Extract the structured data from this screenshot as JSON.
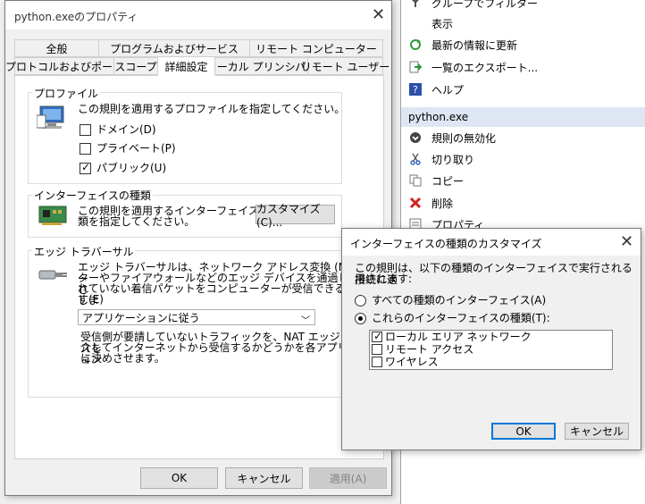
{
  "actions_pane": {
    "items_top": [
      {
        "label": "グループでフィルター",
        "icon": "filter-icon"
      },
      {
        "label": "表示",
        "icon": ""
      },
      {
        "label": "最新の情報に更新",
        "icon": "refresh-icon"
      },
      {
        "label": "一覧のエクスポート...",
        "icon": "export-icon"
      },
      {
        "label": "ヘルプ",
        "icon": "help-icon"
      }
    ],
    "section_title": "python.exe",
    "items_section": [
      {
        "label": "規則の無効化",
        "icon": "disable-icon"
      },
      {
        "label": "切り取り",
        "icon": "cut-icon"
      },
      {
        "label": "コピー",
        "icon": "copy-icon"
      },
      {
        "label": "削除",
        "icon": "delete-icon"
      },
      {
        "label": "プロパティ",
        "icon": "properties-icon"
      }
    ]
  },
  "props_dialog": {
    "title": "python.exeのプロパティ",
    "tabs_row1": [
      "全般",
      "プログラムおよびサービス",
      "リモート コンピューター"
    ],
    "tabs_row2": [
      "プロトコルおよびポート",
      "スコープ",
      "詳細設定",
      "ローカル プリンシパル",
      "リモート ユーザー"
    ],
    "profile": {
      "label": "プロファイル",
      "description": "この規則を適用するプロファイルを指定してください。",
      "options": [
        {
          "label": "ドメイン(D)",
          "checked": false
        },
        {
          "label": "プライベート(P)",
          "checked": false
        },
        {
          "label": "パブリック(U)",
          "checked": true
        }
      ]
    },
    "interface": {
      "label": "インターフェイスの種類",
      "desc1": "この規則を適用するインターフェイスの種",
      "desc2": "類を指定してください。",
      "customize_button": "カスタマイズ(C)..."
    },
    "edge": {
      "label": "エッジ トラバーサル",
      "desc1": "エッジ トラバーサルは、ネットワーク アドレス変換 (NAT) ルー",
      "desc2": "ターやファイアウォールなどのエッジ デバイスを通過した要請さ",
      "desc3": "れていない着信パケットをコンピューターが受信できるようにしま",
      "desc4": "す(E)",
      "select_value": "アプリケーションに従う",
      "note1": "受信側が要請していないトラフィックを、NAT エッジ デバイスを",
      "note2": "介してインターネットから受信するかどうかを各アプリケーション",
      "note3": "に決めさせます。"
    },
    "buttons": {
      "ok": "OK",
      "cancel": "キャンセル",
      "apply": "適用(A)"
    }
  },
  "customize_dialog": {
    "title": "インターフェイスの種類のカスタマイズ",
    "desc1": "この規則は、以下の種類のインターフェイスで実行される接続に適",
    "desc2": "用されます:",
    "radio_all": "すべての種類のインターフェイス(A)",
    "radio_these": "これらのインターフェイスの種類(T):",
    "interfaces": [
      {
        "label": "ローカル エリア ネットワーク",
        "checked": true
      },
      {
        "label": "リモート アクセス",
        "checked": false
      },
      {
        "label": "ワイヤレス",
        "checked": false
      }
    ],
    "buttons": {
      "ok": "OK",
      "cancel": "キャンセル"
    }
  }
}
